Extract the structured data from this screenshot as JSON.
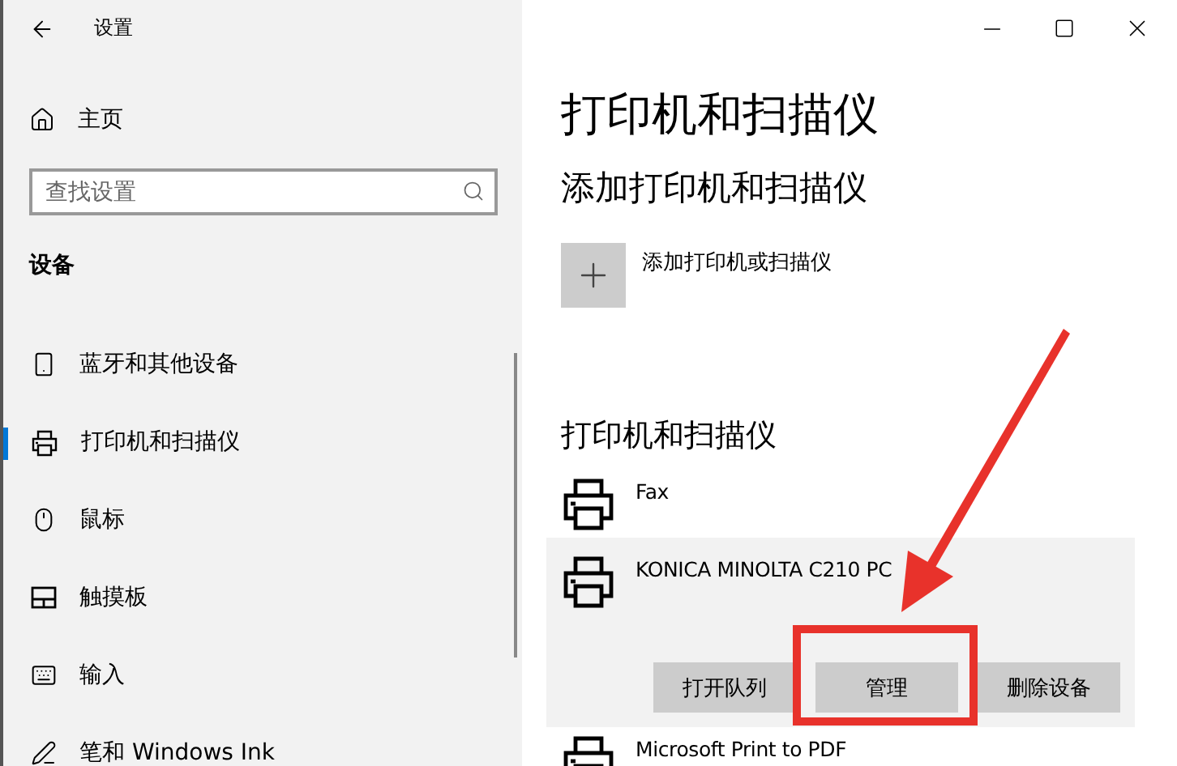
{
  "window": {
    "title": "设置"
  },
  "sidebar": {
    "home": "主页",
    "search": {
      "placeholder": "查找设置"
    },
    "section": "设备",
    "items": [
      {
        "label": "蓝牙和其他设备",
        "kind": "devices",
        "selected": false
      },
      {
        "label": "打印机和扫描仪",
        "kind": "printer",
        "selected": true
      },
      {
        "label": "鼠标",
        "kind": "mouse",
        "selected": false
      },
      {
        "label": "触摸板",
        "kind": "touchpad",
        "selected": false
      },
      {
        "label": "输入",
        "kind": "keyboard",
        "selected": false
      },
      {
        "label": "笔和 Windows Ink",
        "kind": "pen",
        "selected": false
      }
    ]
  },
  "main": {
    "title": "打印机和扫描仪",
    "add_heading": "添加打印机和扫描仪",
    "add_label": "添加打印机或扫描仪",
    "list_heading": "打印机和扫描仪",
    "printers": [
      {
        "name": "Fax",
        "selected": false
      },
      {
        "name": "KONICA MINOLTA C210 PC",
        "selected": true,
        "actions": [
          "打开队列",
          "管理",
          "删除设备"
        ]
      },
      {
        "name": "Microsoft Print to PDF",
        "selected": false
      }
    ]
  }
}
